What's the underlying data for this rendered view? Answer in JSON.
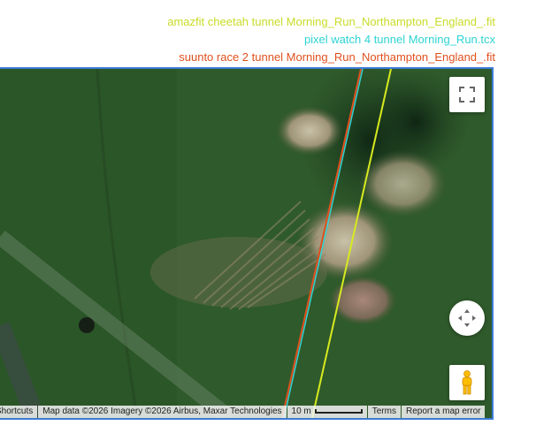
{
  "legend": [
    {
      "label": "amazfit cheetah tunnel Morning_Run_Northampton_England_.fit",
      "color": "#c8dc28"
    },
    {
      "label": "pixel watch 4 tunnel Morning_Run.tcx",
      "color": "#2ed3d3"
    },
    {
      "label": "suunto race 2 tunnel Morning_Run_Northampton_England_.fit",
      "color": "#e0501e"
    }
  ],
  "map": {
    "fullscreen_icon": "fullscreen-icon",
    "pan_icon": "pan-arrows-icon",
    "pegman_icon": "pegman-icon",
    "attribution": {
      "shortcuts": "Shortcuts",
      "map_data": "Map data ©2026 Imagery ©2026 Airbus, Maxar Technologies",
      "scale": "10 m",
      "terms": "Terms",
      "report": "Report a map error"
    }
  }
}
